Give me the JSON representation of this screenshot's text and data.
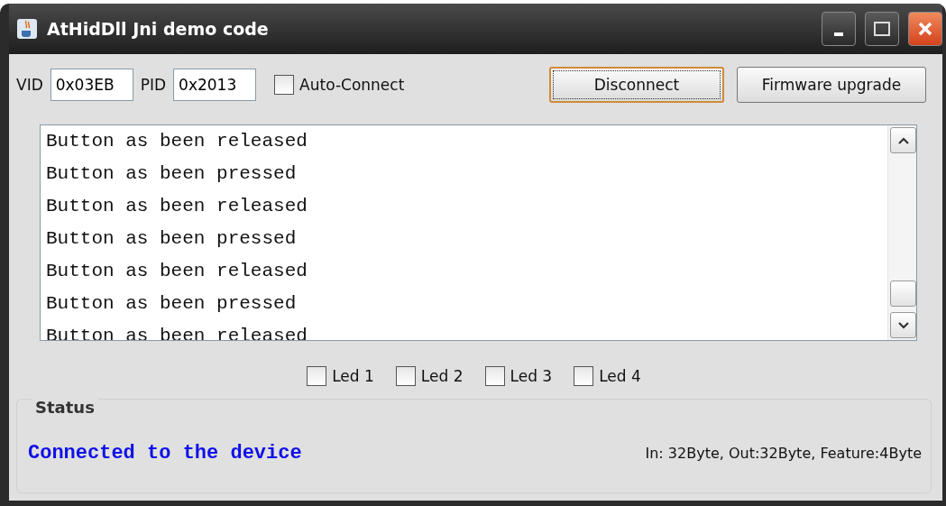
{
  "window": {
    "title": "AtHidDll Jni demo code"
  },
  "connection": {
    "vid_label": "VID",
    "vid": "0x03EB",
    "pid_label": "PID",
    "pid": "0x2013",
    "auto_connect": {
      "label": "Auto-Connect",
      "checked": false
    }
  },
  "buttons": [
    {
      "label": "Disconnect",
      "focused": true
    },
    {
      "label": "Firmware upgrade",
      "focused": false
    }
  ],
  "log": [
    "Button as been released",
    "Button as been pressed",
    "Button as been released",
    "Button as been pressed",
    "Button as been released",
    "Button as been pressed",
    "Button as been released"
  ],
  "leds": [
    {
      "label": "Led 1",
      "checked": false
    },
    {
      "label": "Led 2",
      "checked": false
    },
    {
      "label": "Led 3",
      "checked": false
    },
    {
      "label": "Led 4",
      "checked": false
    }
  ],
  "status": {
    "title": "Status",
    "message": "Connected to the device",
    "info": "In: 32Byte, Out:32Byte, Feature:4Byte"
  }
}
